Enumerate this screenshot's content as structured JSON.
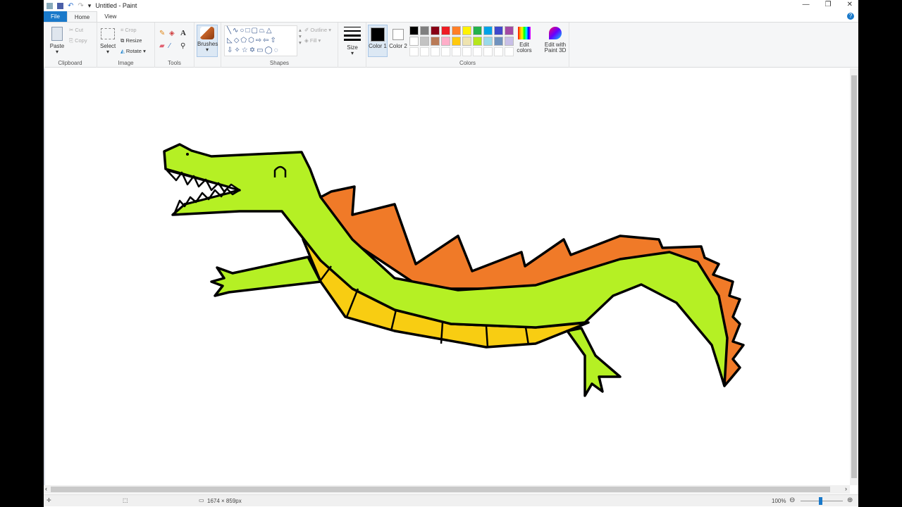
{
  "title": "Untitled - Paint",
  "tabs": [
    "File",
    "Home",
    "View"
  ],
  "clipboard": {
    "paste": "Paste",
    "cut": "Cut",
    "copy": "Copy",
    "label": "Clipboard"
  },
  "image": {
    "select": "Select",
    "crop": "Crop",
    "resize": "Resize",
    "rotate": "Rotate",
    "label": "Image"
  },
  "tools": {
    "label": "Tools",
    "brushes": "Brushes"
  },
  "shapes": {
    "label": "Shapes",
    "outline": "Outline",
    "fill": "Fill"
  },
  "size": {
    "label": "Size"
  },
  "colors": {
    "color1": "Color 1",
    "color2": "Color 2",
    "edit": "Edit colors",
    "paint3d": "Edit with Paint 3D",
    "label": "Colors",
    "row1": [
      "#000000",
      "#7f7f7f",
      "#880015",
      "#ed1c24",
      "#ff7f27",
      "#fff200",
      "#22b14c",
      "#00a2e8",
      "#3f48cc",
      "#a349a4"
    ],
    "row2": [
      "#ffffff",
      "#c3c3c3",
      "#b97a57",
      "#ffaec9",
      "#ffc90e",
      "#efe4b0",
      "#b5e61d",
      "#99d9ea",
      "#7092be",
      "#c8bfe7"
    ],
    "color1_value": "#000000",
    "color2_value": "#ffffff"
  },
  "drawing": {
    "green": "#b5f024",
    "orange": "#f07a28",
    "yellow": "#f8cd12"
  },
  "status": {
    "dimensions": "1674 × 859px",
    "zoom": "100%"
  }
}
